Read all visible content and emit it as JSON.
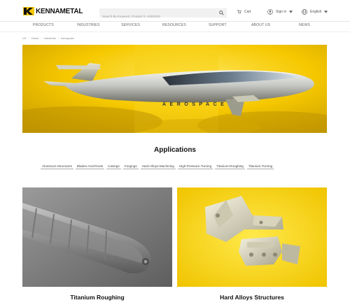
{
  "brand": {
    "name": "KENNAMETAL"
  },
  "search": {
    "placeholder": "Search By Keyword, Product #, ANSI/ISO"
  },
  "utilities": {
    "cart": "Cart",
    "sign_in": "Sign in",
    "language": "English"
  },
  "nav": {
    "items": [
      "PRODUCTS",
      "INDUSTRIES",
      "SERVICES",
      "RESOURCES",
      "SUPPORT",
      "ABOUT US",
      "NEWS"
    ]
  },
  "breadcrumb": {
    "items": [
      "US",
      "Home",
      "Industries",
      "Aerospace"
    ]
  },
  "hero": {
    "title": "AEROSPACE"
  },
  "applications": {
    "title": "Applications",
    "chips": [
      "Aluminum-Structures",
      "Blades-And-Roots",
      "Casings",
      "Forgings",
      "Hard-Alloys-Machining",
      "High-Pressure-Turning",
      "Titanium-Roughing",
      "Titanium-Turning"
    ]
  },
  "cards": [
    {
      "label": "Titanium Roughing"
    },
    {
      "label": "Hard Alloys Structures"
    }
  ],
  "colors": {
    "brand_yellow": "#f5c800",
    "text": "#111111"
  }
}
